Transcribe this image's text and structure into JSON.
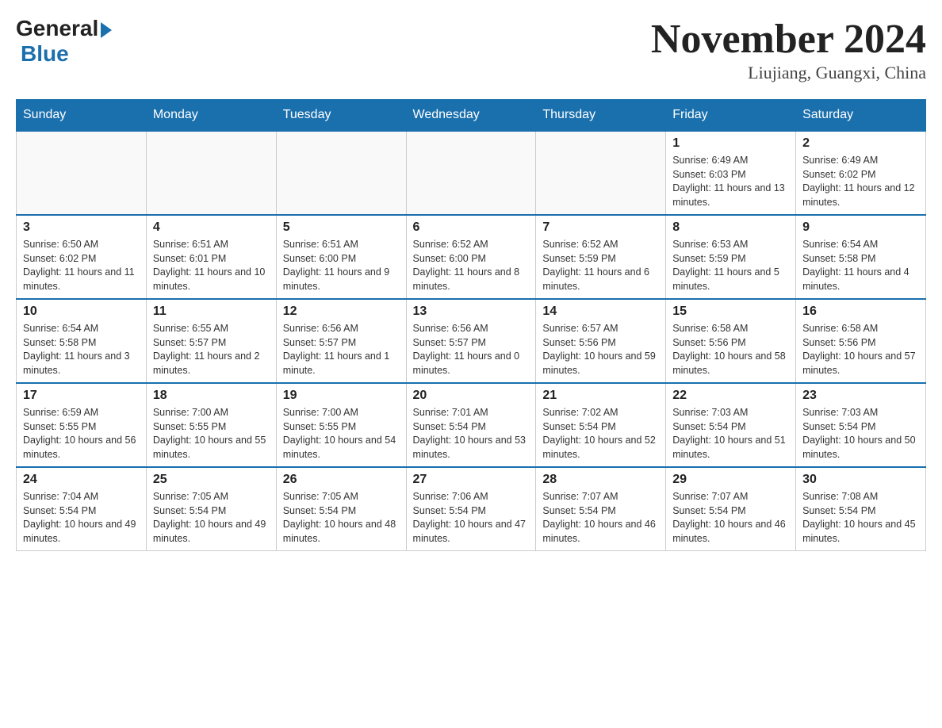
{
  "header": {
    "logo_general": "General",
    "logo_blue": "Blue",
    "month_title": "November 2024",
    "location": "Liujiang, Guangxi, China"
  },
  "days_of_week": [
    "Sunday",
    "Monday",
    "Tuesday",
    "Wednesday",
    "Thursday",
    "Friday",
    "Saturday"
  ],
  "weeks": [
    [
      {
        "day": "",
        "info": ""
      },
      {
        "day": "",
        "info": ""
      },
      {
        "day": "",
        "info": ""
      },
      {
        "day": "",
        "info": ""
      },
      {
        "day": "",
        "info": ""
      },
      {
        "day": "1",
        "info": "Sunrise: 6:49 AM\nSunset: 6:03 PM\nDaylight: 11 hours and 13 minutes."
      },
      {
        "day": "2",
        "info": "Sunrise: 6:49 AM\nSunset: 6:02 PM\nDaylight: 11 hours and 12 minutes."
      }
    ],
    [
      {
        "day": "3",
        "info": "Sunrise: 6:50 AM\nSunset: 6:02 PM\nDaylight: 11 hours and 11 minutes."
      },
      {
        "day": "4",
        "info": "Sunrise: 6:51 AM\nSunset: 6:01 PM\nDaylight: 11 hours and 10 minutes."
      },
      {
        "day": "5",
        "info": "Sunrise: 6:51 AM\nSunset: 6:00 PM\nDaylight: 11 hours and 9 minutes."
      },
      {
        "day": "6",
        "info": "Sunrise: 6:52 AM\nSunset: 6:00 PM\nDaylight: 11 hours and 8 minutes."
      },
      {
        "day": "7",
        "info": "Sunrise: 6:52 AM\nSunset: 5:59 PM\nDaylight: 11 hours and 6 minutes."
      },
      {
        "day": "8",
        "info": "Sunrise: 6:53 AM\nSunset: 5:59 PM\nDaylight: 11 hours and 5 minutes."
      },
      {
        "day": "9",
        "info": "Sunrise: 6:54 AM\nSunset: 5:58 PM\nDaylight: 11 hours and 4 minutes."
      }
    ],
    [
      {
        "day": "10",
        "info": "Sunrise: 6:54 AM\nSunset: 5:58 PM\nDaylight: 11 hours and 3 minutes."
      },
      {
        "day": "11",
        "info": "Sunrise: 6:55 AM\nSunset: 5:57 PM\nDaylight: 11 hours and 2 minutes."
      },
      {
        "day": "12",
        "info": "Sunrise: 6:56 AM\nSunset: 5:57 PM\nDaylight: 11 hours and 1 minute."
      },
      {
        "day": "13",
        "info": "Sunrise: 6:56 AM\nSunset: 5:57 PM\nDaylight: 11 hours and 0 minutes."
      },
      {
        "day": "14",
        "info": "Sunrise: 6:57 AM\nSunset: 5:56 PM\nDaylight: 10 hours and 59 minutes."
      },
      {
        "day": "15",
        "info": "Sunrise: 6:58 AM\nSunset: 5:56 PM\nDaylight: 10 hours and 58 minutes."
      },
      {
        "day": "16",
        "info": "Sunrise: 6:58 AM\nSunset: 5:56 PM\nDaylight: 10 hours and 57 minutes."
      }
    ],
    [
      {
        "day": "17",
        "info": "Sunrise: 6:59 AM\nSunset: 5:55 PM\nDaylight: 10 hours and 56 minutes."
      },
      {
        "day": "18",
        "info": "Sunrise: 7:00 AM\nSunset: 5:55 PM\nDaylight: 10 hours and 55 minutes."
      },
      {
        "day": "19",
        "info": "Sunrise: 7:00 AM\nSunset: 5:55 PM\nDaylight: 10 hours and 54 minutes."
      },
      {
        "day": "20",
        "info": "Sunrise: 7:01 AM\nSunset: 5:54 PM\nDaylight: 10 hours and 53 minutes."
      },
      {
        "day": "21",
        "info": "Sunrise: 7:02 AM\nSunset: 5:54 PM\nDaylight: 10 hours and 52 minutes."
      },
      {
        "day": "22",
        "info": "Sunrise: 7:03 AM\nSunset: 5:54 PM\nDaylight: 10 hours and 51 minutes."
      },
      {
        "day": "23",
        "info": "Sunrise: 7:03 AM\nSunset: 5:54 PM\nDaylight: 10 hours and 50 minutes."
      }
    ],
    [
      {
        "day": "24",
        "info": "Sunrise: 7:04 AM\nSunset: 5:54 PM\nDaylight: 10 hours and 49 minutes."
      },
      {
        "day": "25",
        "info": "Sunrise: 7:05 AM\nSunset: 5:54 PM\nDaylight: 10 hours and 49 minutes."
      },
      {
        "day": "26",
        "info": "Sunrise: 7:05 AM\nSunset: 5:54 PM\nDaylight: 10 hours and 48 minutes."
      },
      {
        "day": "27",
        "info": "Sunrise: 7:06 AM\nSunset: 5:54 PM\nDaylight: 10 hours and 47 minutes."
      },
      {
        "day": "28",
        "info": "Sunrise: 7:07 AM\nSunset: 5:54 PM\nDaylight: 10 hours and 46 minutes."
      },
      {
        "day": "29",
        "info": "Sunrise: 7:07 AM\nSunset: 5:54 PM\nDaylight: 10 hours and 46 minutes."
      },
      {
        "day": "30",
        "info": "Sunrise: 7:08 AM\nSunset: 5:54 PM\nDaylight: 10 hours and 45 minutes."
      }
    ]
  ]
}
